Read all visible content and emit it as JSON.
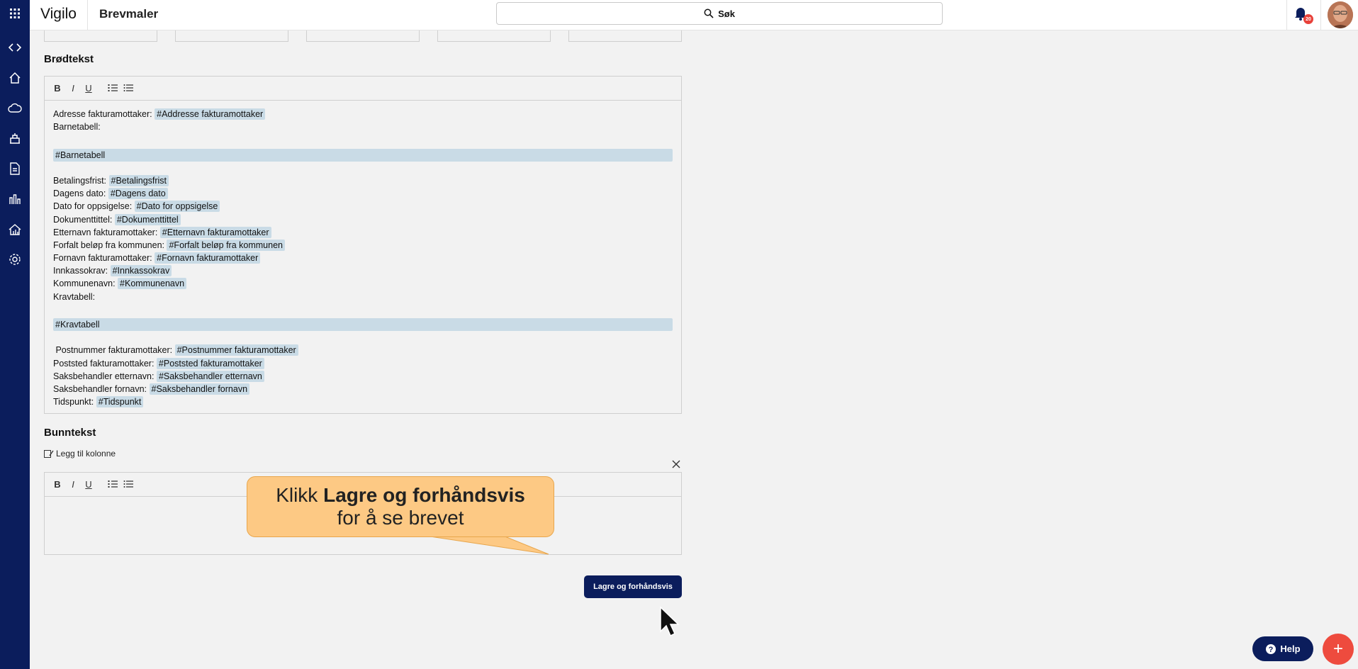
{
  "app": {
    "brand": "Vigilo",
    "page_title": "Brevmaler"
  },
  "search": {
    "label": "Søk"
  },
  "notifications": {
    "count": "20"
  },
  "rail_icons": [
    "apps-grid-icon",
    "code-icon",
    "home-icon",
    "cloud-icon",
    "building-icon",
    "document-icon",
    "bar-chart-icon",
    "house-chart-icon",
    "gear-icon"
  ],
  "body_section": {
    "title": "Brødtekst",
    "lines": [
      {
        "label": "Adresse fakturamottaker: ",
        "tag": "#Addresse fakturamottaker"
      },
      {
        "label": "Barnetabell:",
        "tag": ""
      },
      {
        "label": "",
        "tag": ""
      },
      {
        "label": "",
        "block": "#Barnetabell"
      },
      {
        "label": "",
        "tag": ""
      },
      {
        "label": "Betalingsfrist: ",
        "tag": "#Betalingsfrist"
      },
      {
        "label": "Dagens dato: ",
        "tag": "#Dagens dato"
      },
      {
        "label": "Dato for oppsigelse: ",
        "tag": "#Dato for oppsigelse"
      },
      {
        "label": "Dokumenttittel: ",
        "tag": "#Dokumenttittel"
      },
      {
        "label": "Etternavn fakturamottaker: ",
        "tag": "#Etternavn fakturamottaker"
      },
      {
        "label": "Forfalt beløp fra kommunen: ",
        "tag": "#Forfalt beløp fra kommunen"
      },
      {
        "label": "Fornavn fakturamottaker: ",
        "tag": "#Fornavn fakturamottaker"
      },
      {
        "label": "Innkassokrav: ",
        "tag": "#Innkassokrav"
      },
      {
        "label": "Kommunenavn: ",
        "tag": "#Kommunenavn"
      },
      {
        "label": "Kravtabell:",
        "tag": ""
      },
      {
        "label": "",
        "tag": ""
      },
      {
        "label": "",
        "block": "#Kravtabell"
      },
      {
        "label": "",
        "tag": ""
      },
      {
        "label": " Postnummer fakturamottaker: ",
        "tag": "#Postnummer fakturamottaker"
      },
      {
        "label": "Poststed fakturamottaker: ",
        "tag": "#Poststed fakturamottaker"
      },
      {
        "label": "Saksbehandler etternavn: ",
        "tag": "#Saksbehandler etternavn"
      },
      {
        "label": "Saksbehandler fornavn: ",
        "tag": "#Saksbehandler fornavn"
      },
      {
        "label": "Tidspunkt: ",
        "tag": "#Tidspunkt"
      }
    ]
  },
  "footer_section": {
    "title": "Bunntekst",
    "add_column": "Legg til kolonne"
  },
  "toolbar": {
    "bold": "B",
    "italic": "I",
    "underline": "U"
  },
  "save_button": "Lagre og forhåndsvis",
  "callout": {
    "prefix": "Klikk ",
    "bold": "Lagre og forhåndsvis",
    "line2": "for å se brevet"
  },
  "help_button": "Help",
  "fab": "+"
}
